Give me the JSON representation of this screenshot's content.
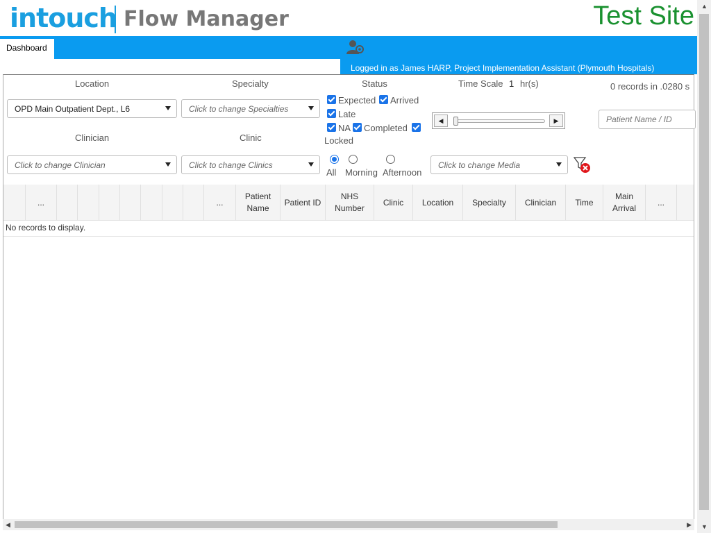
{
  "header": {
    "logo_intouch": "intouch",
    "logo_product": "Flow Manager",
    "site_label": "Test Site"
  },
  "nav": {
    "tab_dashboard": "Dashboard",
    "user_icon": "user-gear-icon",
    "login_text": "Logged in as James HARP, Project Implementation Assistant (Plymouth Hospitals)"
  },
  "filters": {
    "location_label": "Location",
    "location_value": "OPD Main Outpatient Dept., L6",
    "specialty_label": "Specialty",
    "specialty_placeholder": "Click to change Specialties",
    "clinician_label": "Clinician",
    "clinician_placeholder": "Click to change Clinician",
    "clinic_label": "Clinic",
    "clinic_placeholder": "Click to change Clinics",
    "status_label": "Status",
    "status_options": [
      "Expected",
      "Arrived",
      "Late",
      "NA",
      "Completed",
      "Locked"
    ],
    "time_scale_label": "Time Scale",
    "time_scale_value": "1",
    "time_scale_unit": "hr(s)",
    "session_options": [
      "All",
      "Morning",
      "Afternoon"
    ],
    "session_selected": "All",
    "media_placeholder": "Click to change Media",
    "patient_search_placeholder": "Patient Name / ID",
    "records_info": "0 records in .0280 s"
  },
  "grid": {
    "columns": [
      "...",
      "...",
      "Patient Name",
      "Patient ID",
      "NHS Number",
      "Clinic",
      "Location",
      "Specialty",
      "Clinician",
      "Time",
      "Main Arrival",
      "..."
    ],
    "empty_message": "No records to display."
  },
  "colors": {
    "accent": "#0a9bf0",
    "test_site": "#1a9130",
    "checkbox": "#1a73e8"
  }
}
